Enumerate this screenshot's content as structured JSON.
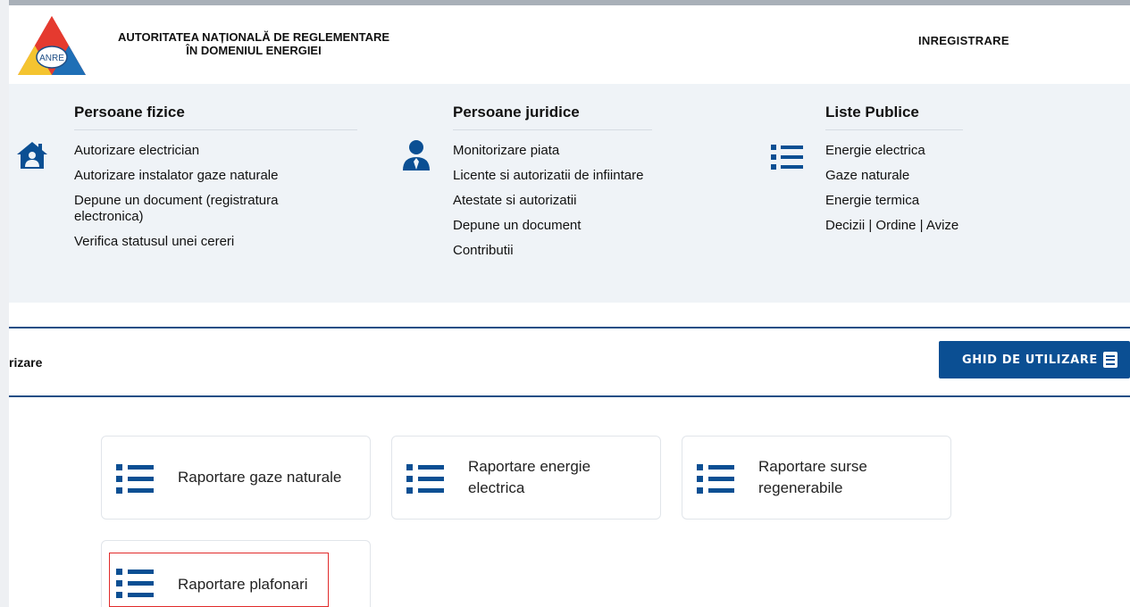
{
  "header": {
    "org_name_line1": "AUTORITATEA NAȚIONALĂ DE REGLEMENTARE",
    "org_name_line2": "ÎN DOMENIUL ENERGIEI",
    "logo_text": "ANRE",
    "register_label": "INREGISTRARE"
  },
  "menu": {
    "columns": [
      {
        "title": "Persoane fizice",
        "icon": "house-user-icon",
        "items": [
          "Autorizare electrician",
          "Autorizare instalator gaze naturale",
          "Depune un document (registratura electronica)",
          "Verifica statusul unei cereri"
        ]
      },
      {
        "title": "Persoane juridice",
        "icon": "user-tie-icon",
        "items": [
          "Monitorizare piata",
          "Licente si autorizatii de infiintare",
          "Atestate si autorizatii",
          "Depune un document",
          "Contributii"
        ]
      },
      {
        "title": "Liste Publice",
        "icon": "list-icon",
        "items": [
          "Energie electrica",
          "Gaze naturale",
          "Energie termica",
          "Decizii | Ordine | Avize"
        ]
      }
    ]
  },
  "section": {
    "title": "rizare",
    "guide_button_label": "GHID DE UTILIZARE"
  },
  "cards": [
    {
      "label": "Raportare gaze naturale",
      "icon": "list-icon"
    },
    {
      "label": "Raportare energie electrica",
      "icon": "list-icon"
    },
    {
      "label": "Raportare surse regenerabile",
      "icon": "list-icon"
    },
    {
      "label": "Raportare plafonari",
      "icon": "list-icon"
    }
  ],
  "colors": {
    "brand_blue": "#0b4f93",
    "menu_bg": "#eff3f7",
    "highlight_red": "#e12b2b"
  }
}
